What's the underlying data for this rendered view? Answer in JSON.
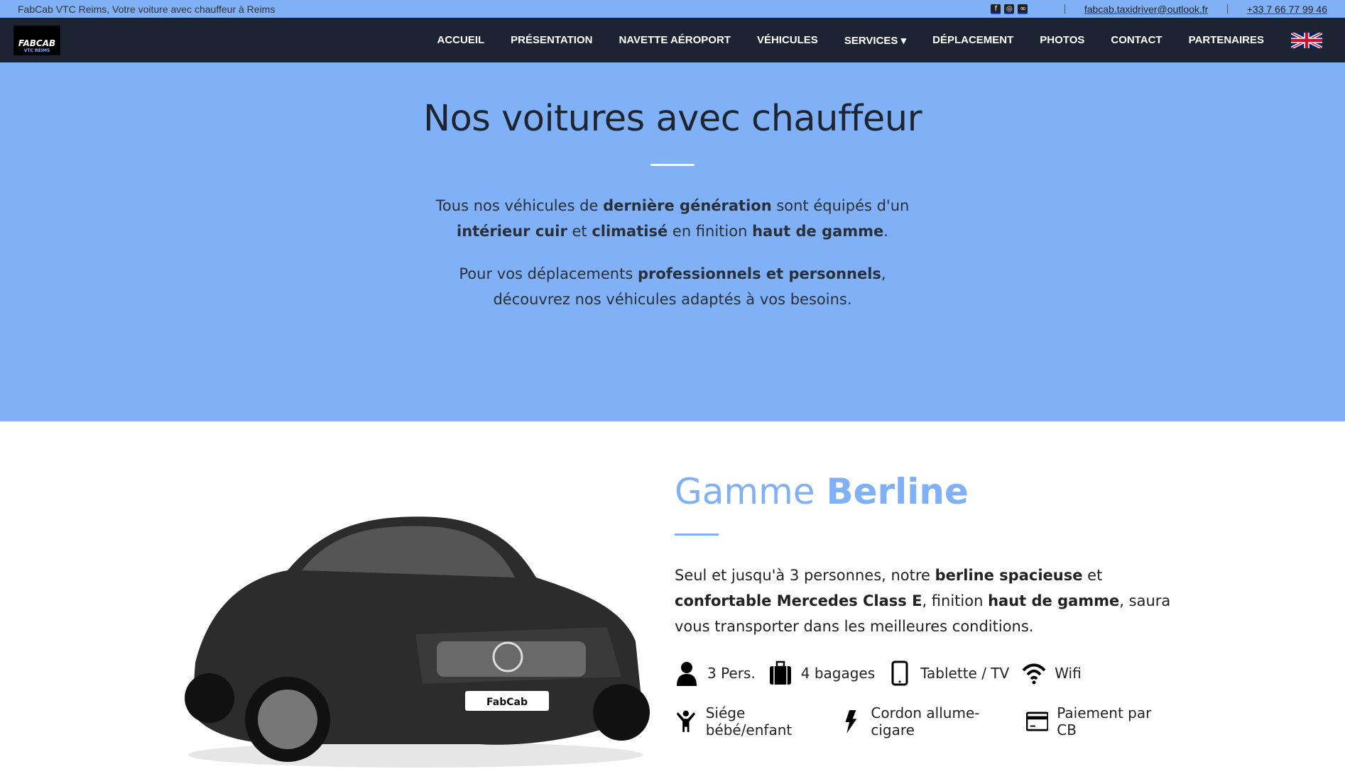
{
  "topbar": {
    "tagline": "FabCab VTC Reims, Votre voiture avec chauffeur à Reims",
    "social": [
      "facebook-icon",
      "instagram-icon",
      "tripadvisor-icon"
    ],
    "email": "fabcab.taxidriver@outlook.fr",
    "phone": "+33 7 66 77 99 46"
  },
  "nav": {
    "logo": "FABCAB",
    "logo_sub": "VTC REIMS",
    "items": [
      "ACCUEIL",
      "PRÉSENTATION",
      "NAVETTE AÉROPORT",
      "VÉHICULES",
      "SERVICES ▾",
      "DÉPLACEMENT",
      "PHOTOS",
      "CONTACT",
      "PARTENAIRES"
    ],
    "language": "uk-flag-icon"
  },
  "hero": {
    "title": "Nos voitures avec chauffeur",
    "p1": [
      {
        "t": "Tous nos véhicules de "
      },
      {
        "b": "dernière génération"
      },
      {
        "t": " sont équipés d'un "
      },
      {
        "b": "intérieur cuir"
      },
      {
        "t": " et "
      },
      {
        "b": "climatisé"
      },
      {
        "t": " en finition "
      },
      {
        "b": "haut de gamme"
      },
      {
        "t": "."
      }
    ],
    "p2": [
      {
        "t": "Pour vos déplacements "
      },
      {
        "b": "professionnels et personnels"
      },
      {
        "t": ", découvrez nos véhicules adaptés à vos besoins."
      }
    ]
  },
  "berline": {
    "title_light": "Gamme ",
    "title_bold": "Berline",
    "plate": "FabCab",
    "desc": [
      {
        "t": "Seul et jusqu'à 3 personnes, notre "
      },
      {
        "b": "berline spacieuse"
      },
      {
        "t": " et "
      },
      {
        "b": "confortable Mercedes Class E"
      },
      {
        "t": ", finition "
      },
      {
        "b": "haut de gamme"
      },
      {
        "t": ", saura vous transporter dans les meilleures conditions."
      }
    ],
    "features": [
      {
        "icon": "person-icon",
        "label": "3 Pers."
      },
      {
        "icon": "suitcase-icon",
        "label": "4 bagages"
      },
      {
        "icon": "tablet-icon",
        "label": "Tablette / TV"
      },
      {
        "icon": "wifi-icon",
        "label": "Wifi"
      },
      {
        "icon": "child-icon",
        "label": "Siége bébé/enfant"
      },
      {
        "icon": "bolt-icon",
        "label": "Cordon allume-cigare"
      },
      {
        "icon": "credit-card-icon",
        "label": "Paiement par CB"
      }
    ]
  },
  "colors": {
    "accent": "#80b0f5",
    "nav": "#1c2433"
  }
}
